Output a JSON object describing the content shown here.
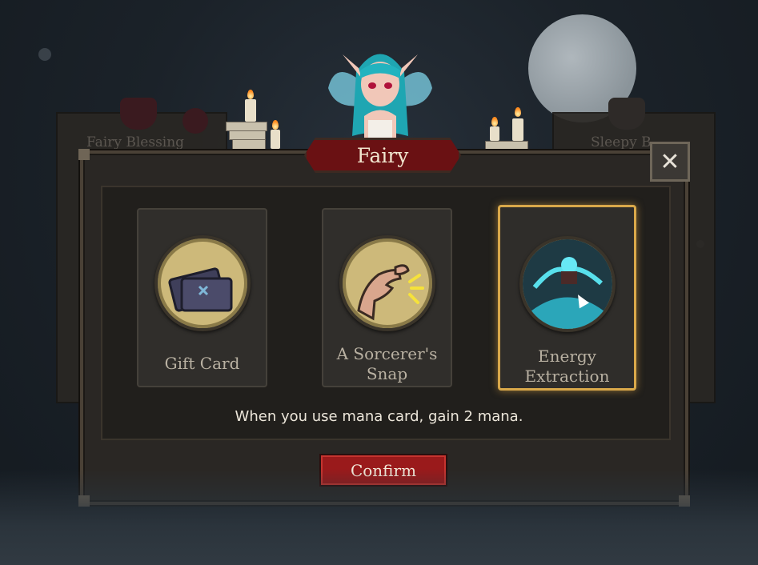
{
  "background": {
    "left_panel_title": "Fairy Blessing",
    "right_panel_title": "Sleepy B"
  },
  "dialog": {
    "title": "Fairy",
    "close_label": "✕",
    "description": "When you use mana card,  gain 2 mana.",
    "confirm_label": "Confirm"
  },
  "cards": [
    {
      "label_lines": [
        "Gift Card"
      ],
      "icon": "gift-card-icon",
      "selected": false
    },
    {
      "label_lines": [
        "A Sorcerer's",
        "Snap"
      ],
      "icon": "snap-icon",
      "selected": false
    },
    {
      "label_lines": [
        "Energy",
        "Extraction"
      ],
      "icon": "energy-extraction-icon",
      "selected": true
    }
  ],
  "colors": {
    "accent_red": "#9a1a1b",
    "selection_gold": "#d9a84a",
    "panel_bg": "#2a2724"
  }
}
